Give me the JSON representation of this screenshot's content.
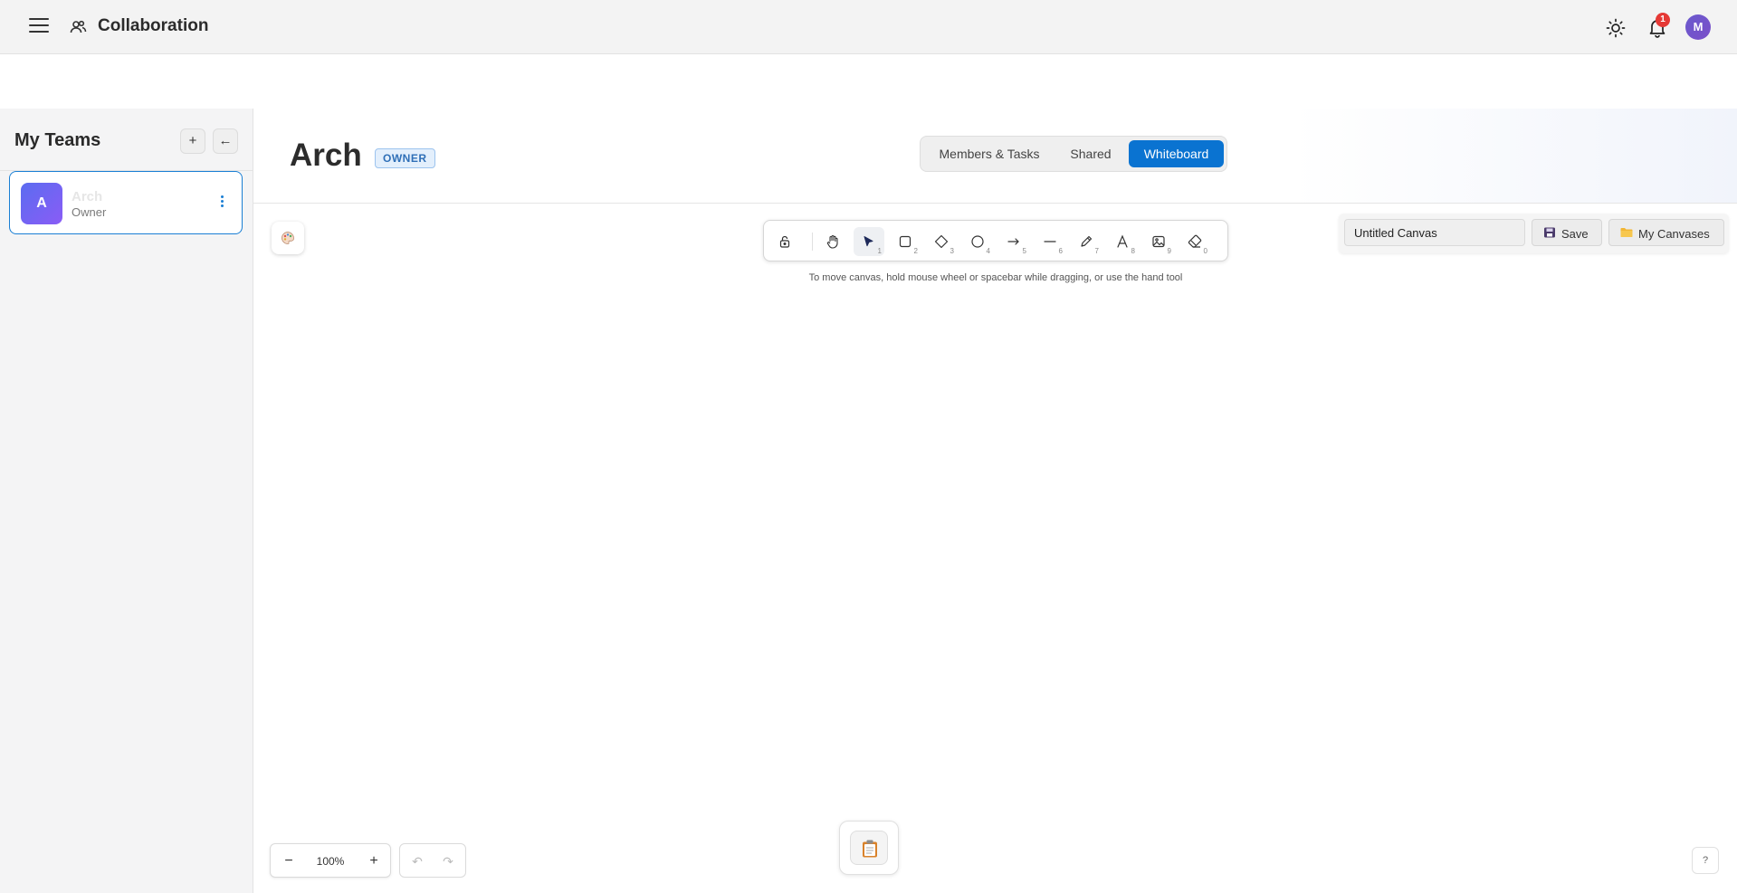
{
  "header": {
    "app_title": "Collaboration",
    "notification_count": "1",
    "user_initial": "M",
    "icons": [
      "menu-icon",
      "team-icon",
      "sun-icon",
      "bell-icon"
    ]
  },
  "sidebar": {
    "title": "My Teams",
    "add_label": "+",
    "collapse_label": "←",
    "teams": [
      {
        "initial": "A",
        "name": "Arch",
        "role": "Owner"
      }
    ]
  },
  "main": {
    "title": "Arch",
    "badge": "OWNER",
    "tabs": [
      {
        "label": "Members & Tasks",
        "active": false
      },
      {
        "label": "Shared",
        "active": false
      },
      {
        "label": "Whiteboard",
        "active": true
      }
    ]
  },
  "whiteboard": {
    "tools": [
      {
        "name": "lock",
        "key": ""
      },
      {
        "name": "hand",
        "key": ""
      },
      {
        "name": "selection",
        "key": "1",
        "active": true
      },
      {
        "name": "rectangle",
        "key": "2"
      },
      {
        "name": "diamond",
        "key": "3"
      },
      {
        "name": "ellipse",
        "key": "4"
      },
      {
        "name": "arrow",
        "key": "5"
      },
      {
        "name": "line",
        "key": "6"
      },
      {
        "name": "draw",
        "key": "7"
      },
      {
        "name": "text",
        "key": "8"
      },
      {
        "name": "image",
        "key": "9"
      },
      {
        "name": "eraser",
        "key": "0"
      }
    ],
    "hint": "To move canvas, hold mouse wheel or spacebar while dragging, or use the hand tool",
    "canvas_name": "Untitled Canvas",
    "save_label": "Save",
    "my_canvases_label": "My Canvases",
    "zoom_out_label": "−",
    "zoom_level": "100%",
    "zoom_in_label": "+",
    "undo_label": "↶",
    "redo_label": "↷",
    "help_label": "?"
  },
  "colors": {
    "accent": "#0a73d1",
    "badge_red": "#e53935",
    "avatar_purple": "#6a5acd"
  }
}
